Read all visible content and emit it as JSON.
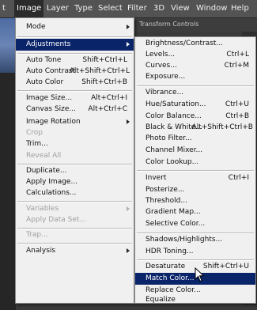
{
  "menubar": {
    "items": [
      "t",
      "Image",
      "Layer",
      "Type",
      "Select",
      "Filter",
      "3D",
      "View",
      "Window",
      "Help"
    ],
    "active": "Image"
  },
  "options_bar_text": "Transform Controls",
  "image_menu": {
    "items": [
      {
        "label": "Mode",
        "submenu": true
      },
      {
        "label": "Adjustments",
        "submenu": true,
        "highlighted": true
      },
      {
        "label": "Auto Tone",
        "shortcut": "Shift+Ctrl+L"
      },
      {
        "label": "Auto Contrast",
        "shortcut": "Alt+Shift+Ctrl+L"
      },
      {
        "label": "Auto Color",
        "shortcut": "Shift+Ctrl+B"
      },
      {
        "label": "Image Size...",
        "shortcut": "Alt+Ctrl+I"
      },
      {
        "label": "Canvas Size...",
        "shortcut": "Alt+Ctrl+C"
      },
      {
        "label": "Image Rotation",
        "submenu": true
      },
      {
        "label": "Crop",
        "disabled": true
      },
      {
        "label": "Trim..."
      },
      {
        "label": "Reveal All",
        "disabled": true
      },
      {
        "label": "Duplicate..."
      },
      {
        "label": "Apply Image..."
      },
      {
        "label": "Calculations..."
      },
      {
        "label": "Variables",
        "submenu": true,
        "disabled": true
      },
      {
        "label": "Apply Data Set...",
        "disabled": true
      },
      {
        "label": "Trap...",
        "disabled": true
      },
      {
        "label": "Analysis",
        "submenu": true
      }
    ]
  },
  "adjustments_menu": {
    "items": [
      {
        "label": "Brightness/Contrast..."
      },
      {
        "label": "Levels...",
        "shortcut": "Ctrl+L"
      },
      {
        "label": "Curves...",
        "shortcut": "Ctrl+M"
      },
      {
        "label": "Exposure..."
      },
      {
        "label": "Vibrance..."
      },
      {
        "label": "Hue/Saturation...",
        "shortcut": "Ctrl+U"
      },
      {
        "label": "Color Balance...",
        "shortcut": "Ctrl+B"
      },
      {
        "label": "Black & White...",
        "shortcut": "Alt+Shift+Ctrl+B"
      },
      {
        "label": "Photo Filter..."
      },
      {
        "label": "Channel Mixer..."
      },
      {
        "label": "Color Lookup..."
      },
      {
        "label": "Invert",
        "shortcut": "Ctrl+I"
      },
      {
        "label": "Posterize..."
      },
      {
        "label": "Threshold..."
      },
      {
        "label": "Gradient Map..."
      },
      {
        "label": "Selective Color..."
      },
      {
        "label": "Shadows/Highlights..."
      },
      {
        "label": "HDR Toning..."
      },
      {
        "label": "Desaturate",
        "shortcut": "Shift+Ctrl+U"
      },
      {
        "label": "Match Color...",
        "highlighted": true
      },
      {
        "label": "Replace Color..."
      },
      {
        "label": "Equalize"
      }
    ]
  },
  "colors": {
    "highlight": "#0a246a",
    "menu_bg": "#f0f0f0",
    "menubar_bg": "#535353"
  }
}
